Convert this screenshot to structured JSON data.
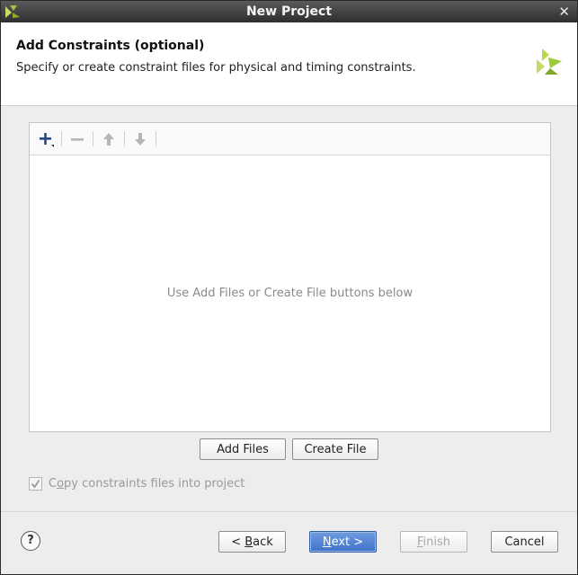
{
  "window": {
    "title": "New Project"
  },
  "header": {
    "title": "Add Constraints (optional)",
    "subtitle": "Specify or create constraint files for physical and timing constraints."
  },
  "toolbar": {
    "icons": [
      "add-icon",
      "remove-icon",
      "move-up-icon",
      "move-down-icon"
    ]
  },
  "file_list": {
    "empty_message": "Use Add Files or Create File buttons below"
  },
  "actions": {
    "add_files": "Add Files",
    "create_file": "Create File"
  },
  "options": {
    "copy_constraints": {
      "pre": "C",
      "mnemonic": "o",
      "rest": "py constraints files into project",
      "checked": true,
      "enabled": false
    }
  },
  "footer": {
    "help": "?",
    "back": {
      "pre": "< ",
      "mnemonic": "B",
      "rest": "ack"
    },
    "next": {
      "pre": "",
      "mnemonic": "N",
      "rest": "ext >"
    },
    "finish": {
      "pre": "",
      "mnemonic": "F",
      "rest": "inish"
    },
    "cancel": "Cancel"
  },
  "colors": {
    "primary_button": "#4a7fd0",
    "titlebar": "#3c3c3c",
    "logo_green": "#9ccc3c"
  }
}
